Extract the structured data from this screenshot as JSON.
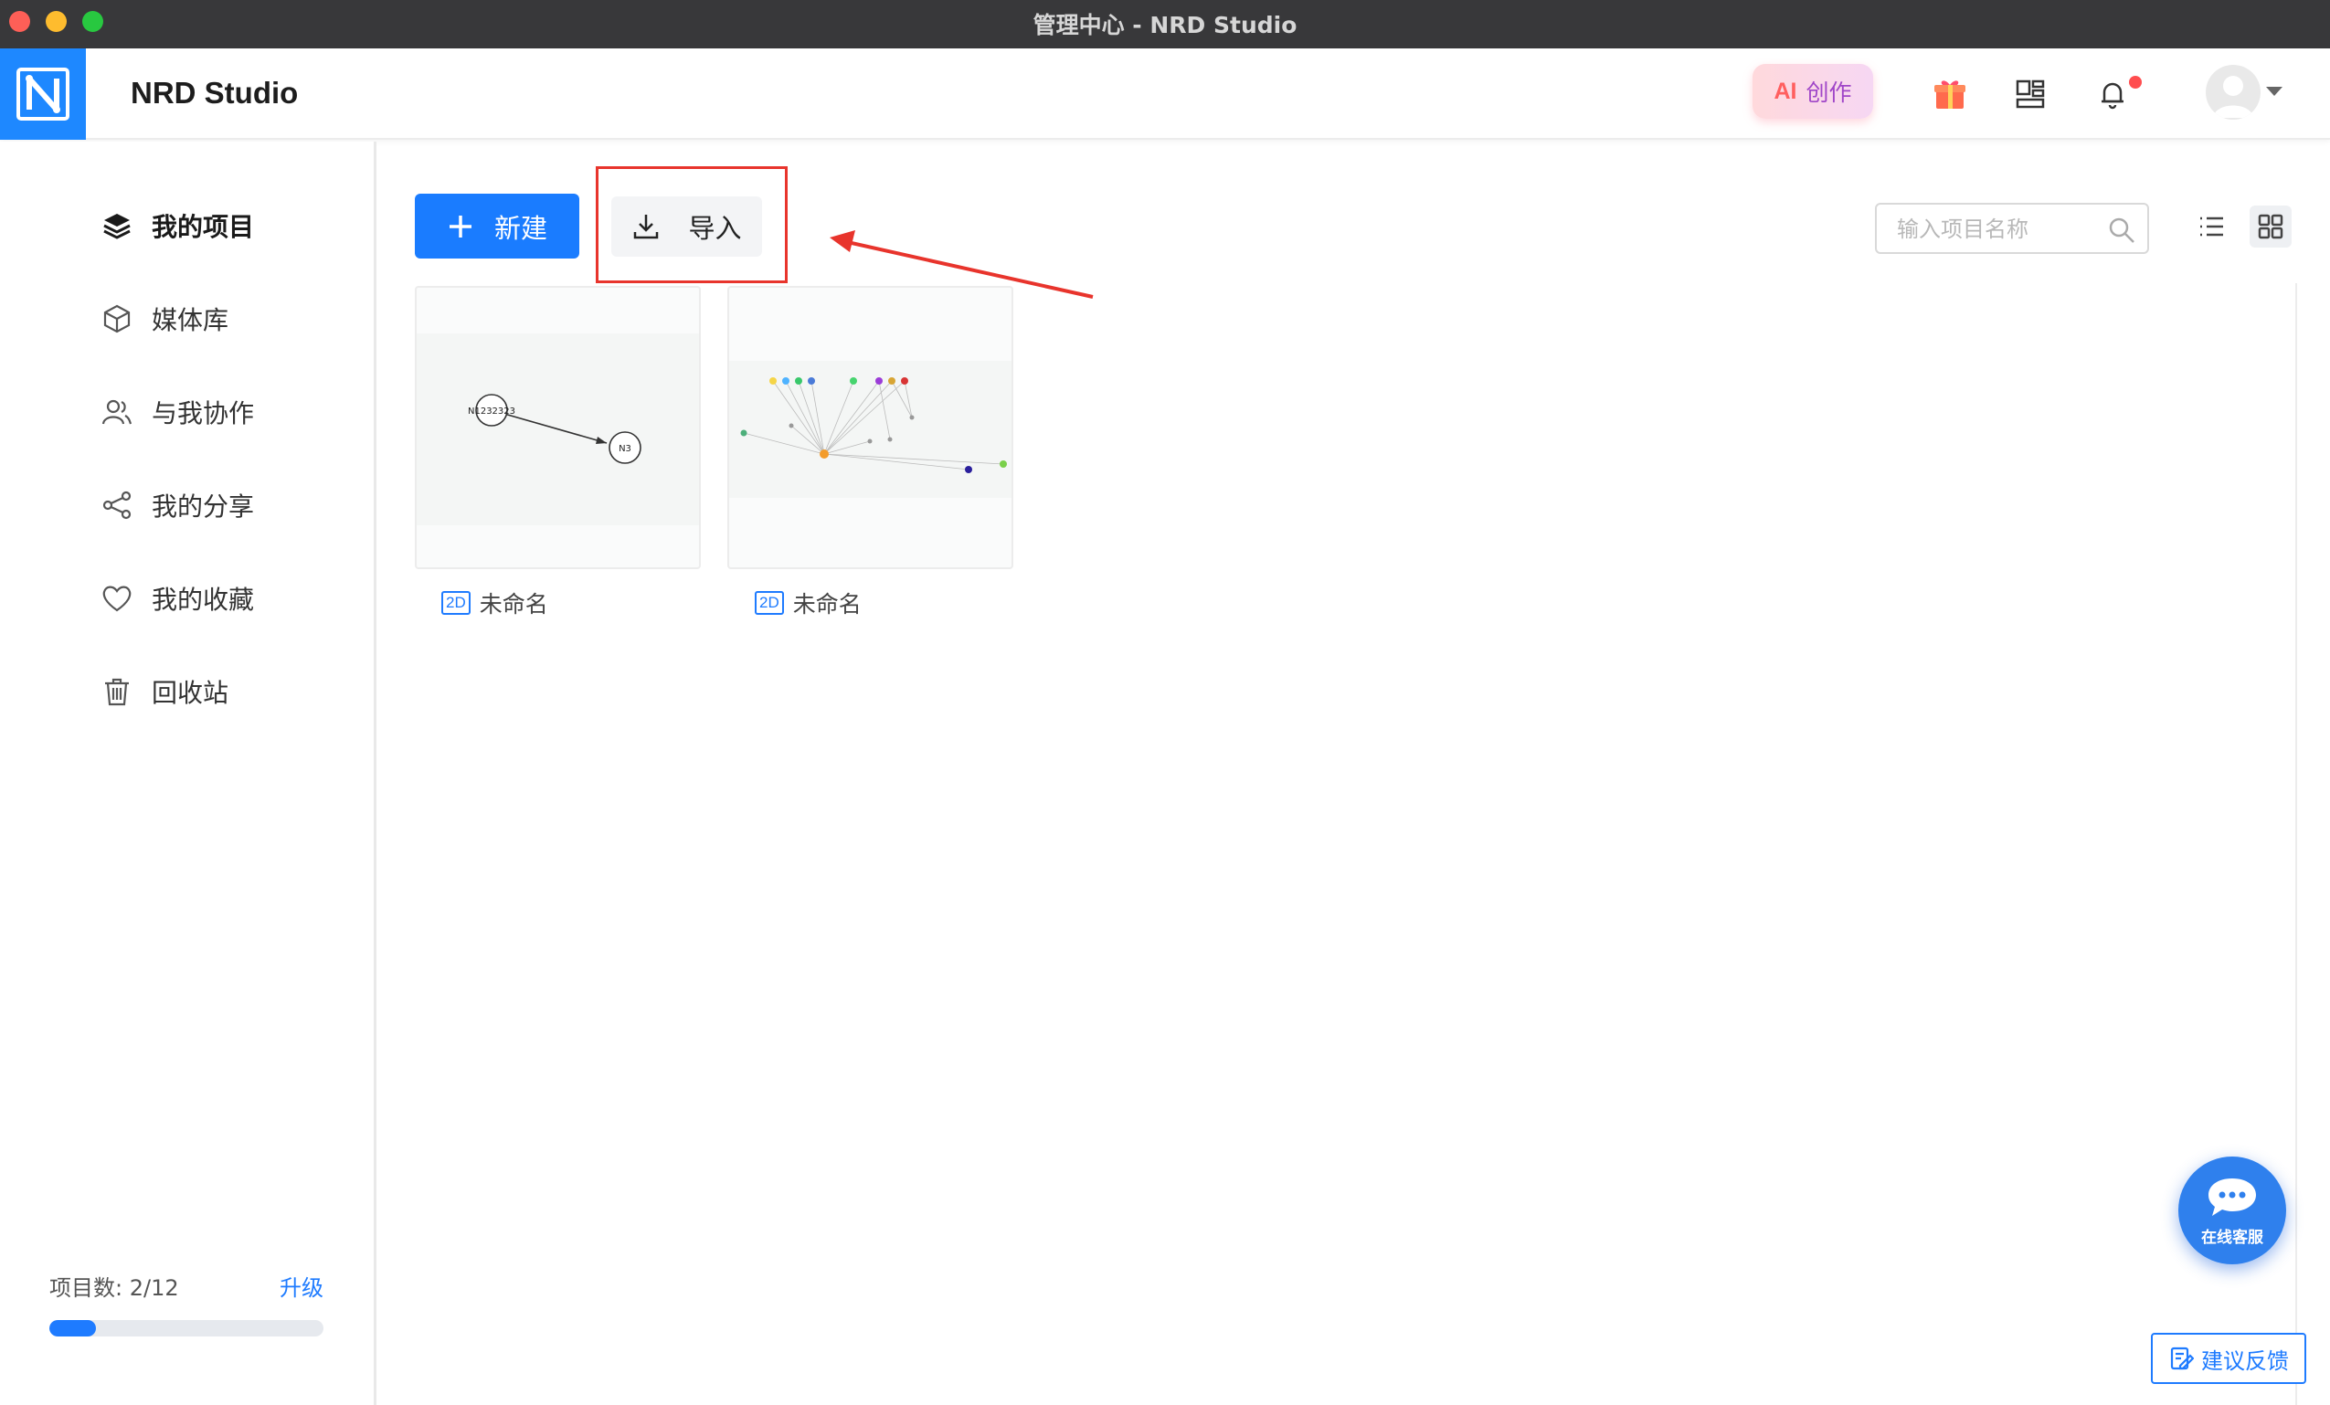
{
  "window": {
    "title": "管理中心 - NRD Studio"
  },
  "header": {
    "app_name": "NRD Studio",
    "ai_button": {
      "mark": "AI",
      "label": "创作"
    },
    "icons": [
      "gift-icon",
      "layout-icon",
      "bell-icon",
      "avatar-icon"
    ],
    "colors": {
      "brand": "#1e88ff",
      "notification_dot": "#ff4d4f"
    }
  },
  "sidebar": {
    "items": [
      {
        "label": "我的项目",
        "icon": "layers-icon",
        "active": true
      },
      {
        "label": "媒体库",
        "icon": "cube-icon",
        "active": false
      },
      {
        "label": "与我协作",
        "icon": "users-icon",
        "active": false
      },
      {
        "label": "我的分享",
        "icon": "share-icon",
        "active": false
      },
      {
        "label": "我的收藏",
        "icon": "heart-icon",
        "active": false
      },
      {
        "label": "回收站",
        "icon": "trash-icon",
        "active": false
      }
    ],
    "quota": {
      "label": "项目数: 2/12",
      "upgrade": "升级",
      "used": 2,
      "total": 12,
      "bar_fill_fraction": 0.17
    }
  },
  "toolbar": {
    "new_label": "新建",
    "import_label": "导入",
    "search_placeholder": "输入项目名称"
  },
  "projects": [
    {
      "name": "未命名",
      "type_tag": "2D",
      "nodes": [
        "N1232323",
        "N3"
      ]
    },
    {
      "name": "未命名",
      "type_tag": "2D"
    }
  ],
  "floating": {
    "chat_label": "在线客服",
    "feedback_label": "建议反馈"
  },
  "annotation": {
    "highlight_color": "#e8342c"
  }
}
